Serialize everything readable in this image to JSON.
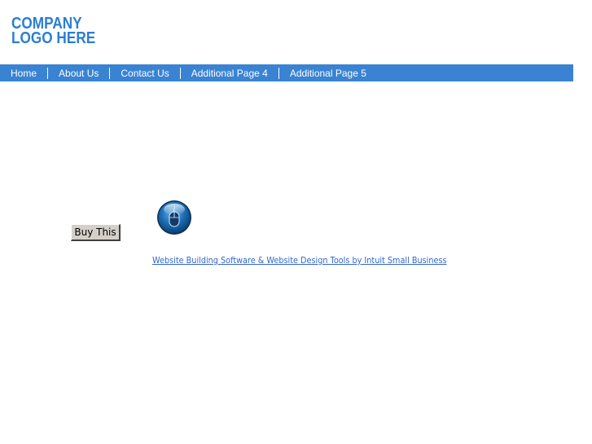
{
  "logo": {
    "line1": "COMPANY",
    "line2": "LOGO HERE",
    "color": "#2b7ed3"
  },
  "nav": {
    "background": "#3a83d2",
    "items": [
      {
        "label": "Home"
      },
      {
        "label": "About Us"
      },
      {
        "label": "Contact Us"
      },
      {
        "label": "Additional Page 4"
      },
      {
        "label": "Additional Page 5"
      }
    ]
  },
  "main": {
    "buy_button_label": "Buy This",
    "icon": "computer-mouse-icon",
    "footer_link": "Website Building Software & Website Design Tools by Intuit Small Business"
  }
}
